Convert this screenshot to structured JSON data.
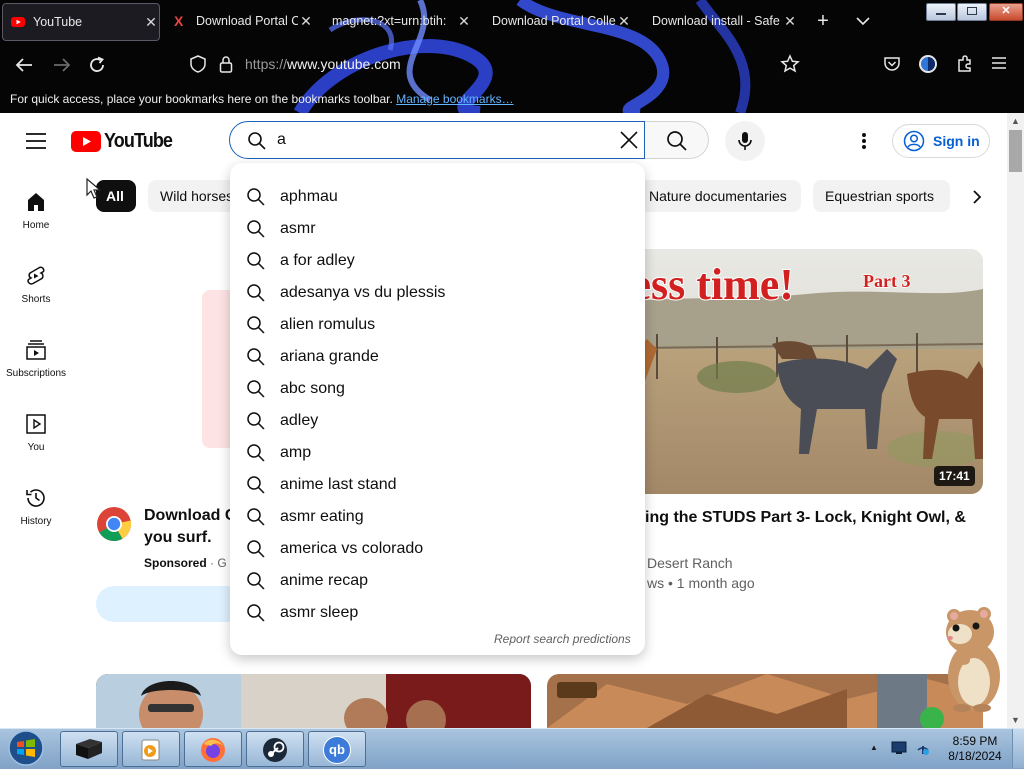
{
  "browser": {
    "tabs": [
      {
        "title": "YouTube",
        "active": true,
        "favicon": "youtube-icon"
      },
      {
        "title": "Download Portal C",
        "active": false,
        "favicon": "x-brand-icon"
      },
      {
        "title": "magnet:?xt=urn:btih:",
        "active": false,
        "favicon": ""
      },
      {
        "title": "Download Portal Collec",
        "active": false,
        "favicon": ""
      },
      {
        "title": "Download install - Safe",
        "active": false,
        "favicon": ""
      }
    ],
    "url_protocol": "https://",
    "url_host": "www.youtube.com",
    "bookmarks_bar": {
      "text": "For quick access, place your bookmarks here on the bookmarks toolbar.",
      "link": "Manage bookmarks…"
    }
  },
  "youtube": {
    "logo_text": "YouTube",
    "search": {
      "value": "a"
    },
    "signin_label": "Sign in",
    "sidebar": [
      {
        "label": "Home",
        "icon": "home-icon"
      },
      {
        "label": "Shorts",
        "icon": "shorts-icon"
      },
      {
        "label": "Subscriptions",
        "icon": "subscriptions-icon"
      },
      {
        "label": "You",
        "icon": "you-icon"
      },
      {
        "label": "History",
        "icon": "history-icon"
      }
    ],
    "chips": [
      "All",
      "Wild horses",
      "Nature documentaries",
      "Equestrian sports"
    ],
    "suggestions": [
      "aphmau",
      "asmr",
      "a for adley",
      "adesanya vs du plessis",
      "alien romulus",
      "ariana grande",
      "abc song",
      "adley",
      "amp",
      "anime last stand",
      "asmr eating",
      "america vs colorado",
      "anime recap",
      "asmr sleep"
    ],
    "report_label": "Report search predictions",
    "ad": {
      "title_line1": "Download C",
      "title_line2": "you surf.",
      "sponsored": "Sponsored",
      "sponsor_suffix": "· G"
    },
    "video": {
      "thumb_text": "ness time!",
      "thumb_subtext": "Part 3",
      "duration": "17:41",
      "title": "ing the STUDS Part 3- Lock, Knight Owl, &",
      "channel": "Desert Ranch",
      "meta": "ws • 1 month ago"
    }
  },
  "taskbar": {
    "time": "8:59 PM",
    "date": "8/18/2024",
    "qb_label": "qb"
  },
  "colors": {
    "youtube_red": "#ff0000",
    "link_blue": "#065fd4",
    "search_focus": "#1c62b9"
  }
}
